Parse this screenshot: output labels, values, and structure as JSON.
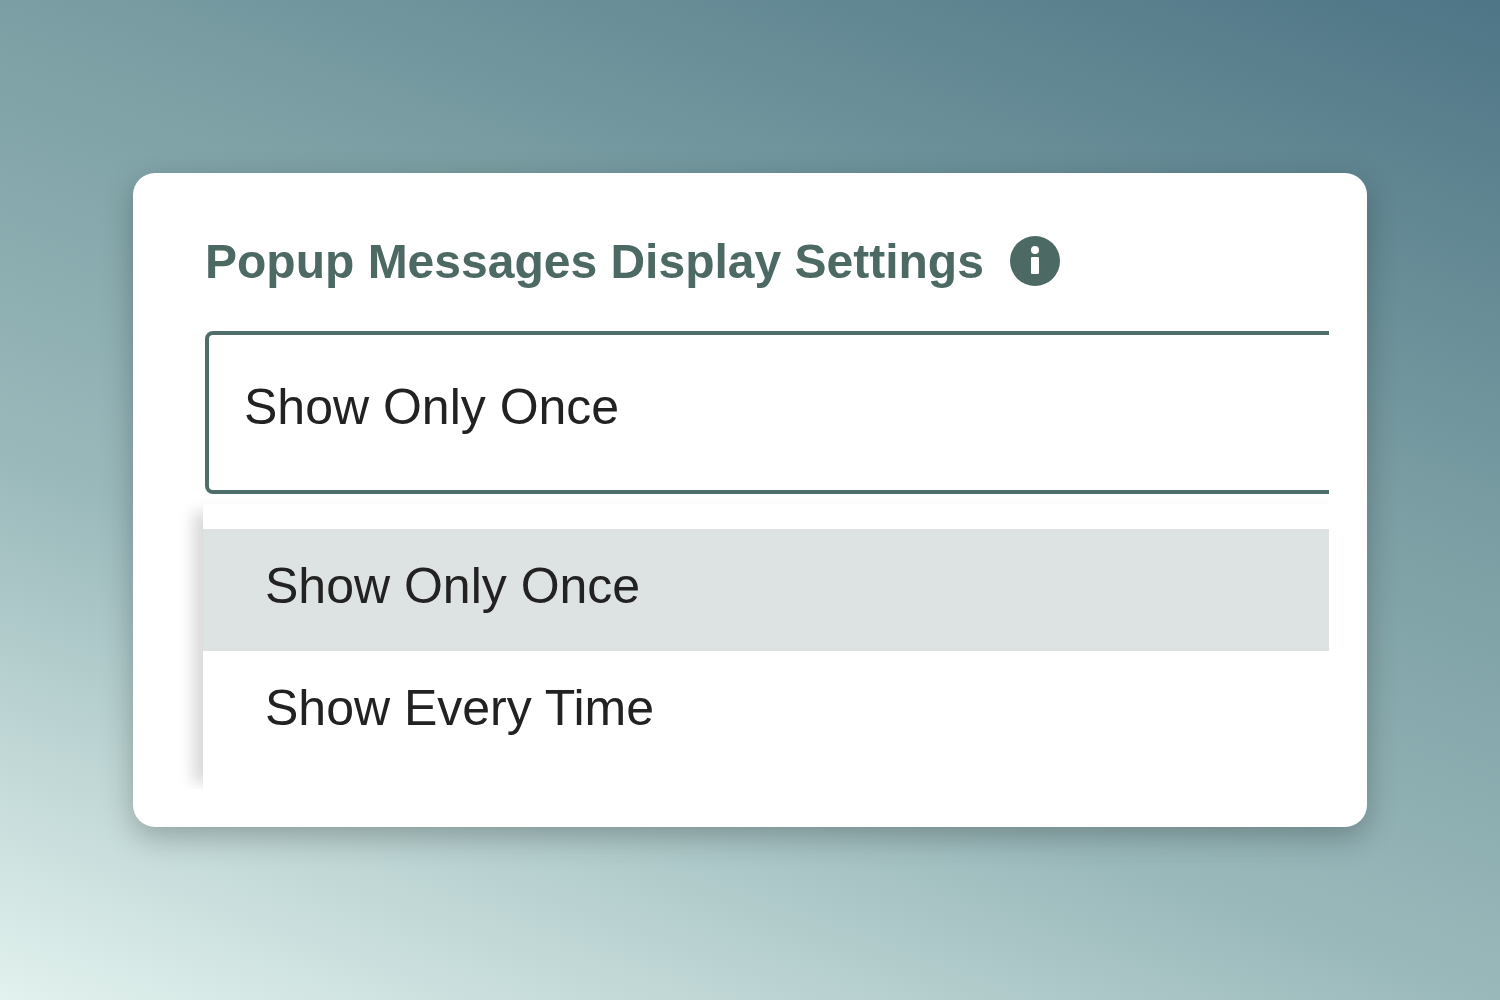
{
  "title": "Popup Messages Display Settings",
  "select": {
    "value": "Show Only Once",
    "options": [
      {
        "label": "Show Only Once",
        "selected": true
      },
      {
        "label": "Show Every Time",
        "selected": false
      }
    ]
  }
}
